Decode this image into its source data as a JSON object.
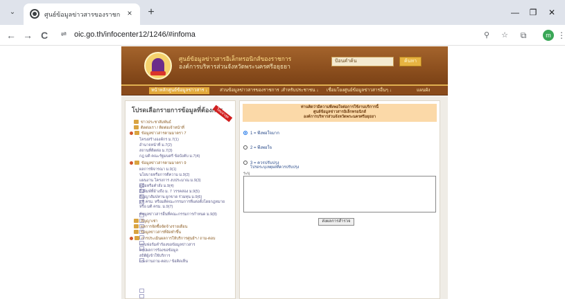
{
  "browser": {
    "tab": {
      "title": "ศูนย์ข้อมูลข่าวสารของราชการ • อ.ก"
    },
    "address": {
      "url": "oic.go.th/infocenter12/1246/#infoma"
    },
    "icons": {
      "tab_list": "chevron-down-icon",
      "favicon": "globe-icon",
      "close": "close-icon",
      "new_tab": "plus-icon",
      "back": "back-arrow-icon",
      "forward": "forward-arrow-icon",
      "reload": "reload-icon",
      "site_info": "site-info-icon",
      "zoom": "zoom-icon",
      "bookmark": "star-icon",
      "extensions": "puzzle-icon",
      "menu": "more-vert-icon"
    },
    "glyphs": {
      "tab_list": "⌄",
      "close": "×",
      "new_tab": "+",
      "minimize": "—",
      "maximize": "❐",
      "win_close": "✕",
      "back": "←",
      "forward": "→",
      "reload": "C",
      "site_info": "⇌",
      "zoom": "⚲",
      "bookmark": "☆",
      "extensions": "⧉",
      "menu": "⋮"
    },
    "profile_initial": "m"
  },
  "site": {
    "title_line1": "ศูนย์ข้อมูลข่าวสารอิเล็กทรอนิกส์ของราชการ",
    "title_line2": "องค์การบริหารส่วนจังหวัดพระนครศรีอยุธยา",
    "search_placeholder": "ป้อนคำค้น",
    "search_button": "ค้นหา",
    "nav": [
      "หน้าหลักศูนย์ข้อมูลข่าวสาร ↓",
      "ส่วนข้อมูลข่าวสารของราชการ ↓",
      "สำหรับประชาชน ↓",
      "เชื่อมโยงศูนย์ข้อมูลข่าวสารอื่นๆ ↓",
      "แผนผัง"
    ]
  },
  "sidebar": {
    "title": "โปรดเลือกรายการข้อมูลที่ต้องการ",
    "ribbon": "ใหม่ล่าสุด",
    "items": [
      "ข่าวประชาสัมพันธ์",
      "ติดต่อเรา / ติดต่อเจ้าหน้าที่",
      "ข้อมูลข่าวสารตามมาตรา 7",
      "โครงสร้างองค์กร ม.7(1)",
      "อำนาจหน้าที่ ม.7(2)",
      "สถานที่ติดต่อ ม.7(3)",
      "กฎ มติ คณะรัฐมนตรี ข้อบังคับ ม.7(4)",
      "ข้อมูลข่าวสารตามมาตรา 9",
      "ผลการพิจารณา ม.9(1)",
      "นโยบายหรือการตีความ ม.9(2)",
      "แผนงาน โครงการ งบประมาณ ม.9(3)",
      "คู่มือหรือคำสั่ง ม.9(4)",
      "สิ่งพิมพ์ที่อ้างถึง ม. 7 วรรคสอง ม.9(5)",
      "สัญญาสัมปทาน ผูกขาด ร่วมทุน ม.9(6)",
      "มติ ครม. หรือมติคณะกรรมการที่แต่งตั้งโดยกฎหมาย หรือ มติ ครม. ม.9(7)",
      "ข้อมูลข่าวสารอื่นที่คณะกรรมการกำหนด ม.9(8)",
      "สัญญาเช่า",
      "ผลการจัดซื้อจัดจ้างรายเดือน",
      "ข้อมูลข่าวสารที่จัดทำขึ้น",
      "การประเมินผลการให้บริการศูนย์ฯ / ถาม-ตอบ",
      "แบบฟอร์มคำร้องขอข้อมูลข่าวสาร",
      "สรุปผลการร้องขอข้อมูล",
      "สถิติผู้เข้าใช้บริการ",
      "กระดานถาม-ตอบ / ข้อคิดเห็น"
    ]
  },
  "survey": {
    "header": [
      "ท่านคิดว่ามีความพึงพอใจต่อการใช้งานบริการนี้",
      "ศูนย์ข้อมูลข่าวสารอิเล็กทรอนิกส์",
      "องค์การบริหารส่วนจังหวัดพระนครศรีอยุธยา"
    ],
    "options": [
      "1 = พึงพอใจมาก",
      "2 = พึงพอใจ",
      "3 = ควรปรับปรุง"
    ],
    "option3_note": "โปรดระบุเหตุผลที่ควรปรับปรุง",
    "note_label": "ระบุ",
    "submit": "ส่งผลการสำรวจ"
  }
}
